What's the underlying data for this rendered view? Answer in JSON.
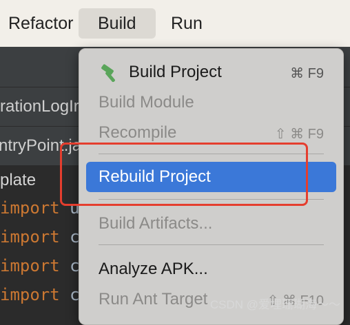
{
  "menubar": {
    "items": [
      "Refactor",
      "Build",
      "Run"
    ]
  },
  "background": {
    "tabs": [
      "rationLogIr",
      "ntryPoint.ja"
    ],
    "editor_label": "plate",
    "code_keyword": "import",
    "code_rest": [
      "u",
      "c",
      "c",
      "c"
    ]
  },
  "dropdown": {
    "items": [
      {
        "label": "Build Project",
        "shortcut": "⌘ F9",
        "icon": "hammer-icon"
      },
      {
        "label": "Build Module",
        "shortcut": ""
      },
      {
        "label": "Recompile",
        "shortcut": "⇧ ⌘ F9"
      },
      {
        "label": "Rebuild Project",
        "shortcut": ""
      },
      {
        "label": "Build Artifacts...",
        "shortcut": ""
      },
      {
        "label": "Analyze APK...",
        "shortcut": ""
      },
      {
        "label": "Run Ant Target",
        "shortcut": "⇧ ⌘ F10"
      }
    ]
  },
  "watermark": "CSDN @爱埋珊瑚海～～",
  "colors": {
    "selected": "#3b78d8",
    "annotation": "#e53e2e",
    "hammer": "#5aa55a"
  }
}
